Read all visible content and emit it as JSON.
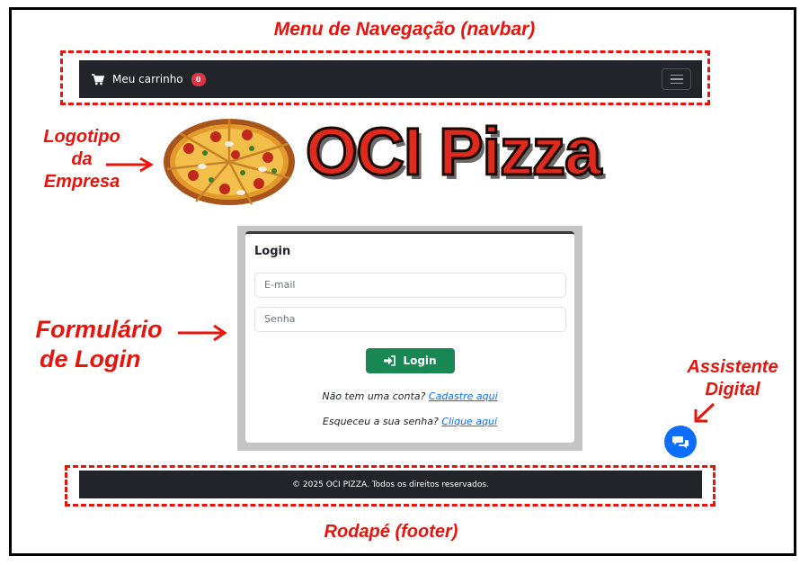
{
  "annotations": {
    "navbar_label": "Menu de Navegação (navbar)",
    "logo_label": [
      "Logotipo",
      "da",
      "Empresa"
    ],
    "form_label": [
      "Formulário",
      "de Login"
    ],
    "assistant_label": [
      "Assistente",
      "Digital"
    ],
    "footer_label": "Rodapé (footer)",
    "accent_color": "#e8140c"
  },
  "navbar": {
    "cart_icon": "cart-icon",
    "cart_label": "Meu carrinho",
    "cart_count": "0",
    "toggler_icon": "hamburger-icon"
  },
  "logo": {
    "text": "OCI Pizza",
    "image": "pizza-image"
  },
  "login": {
    "title": "Login",
    "email_placeholder": "E-mail",
    "password_placeholder": "Senha",
    "button_label": "Login",
    "button_icon": "sign-in-icon",
    "signup_text": "Não tem uma conta?",
    "signup_link": "Cadastre aqui",
    "forgot_text": "Esqueceu a sua senha?",
    "forgot_link": "Clique aqui"
  },
  "chat": {
    "icon": "chat-icon",
    "color": "#0d6efd"
  },
  "footer": {
    "text": "© 2025 OCI PIZZA. Todos os direitos reservados."
  }
}
